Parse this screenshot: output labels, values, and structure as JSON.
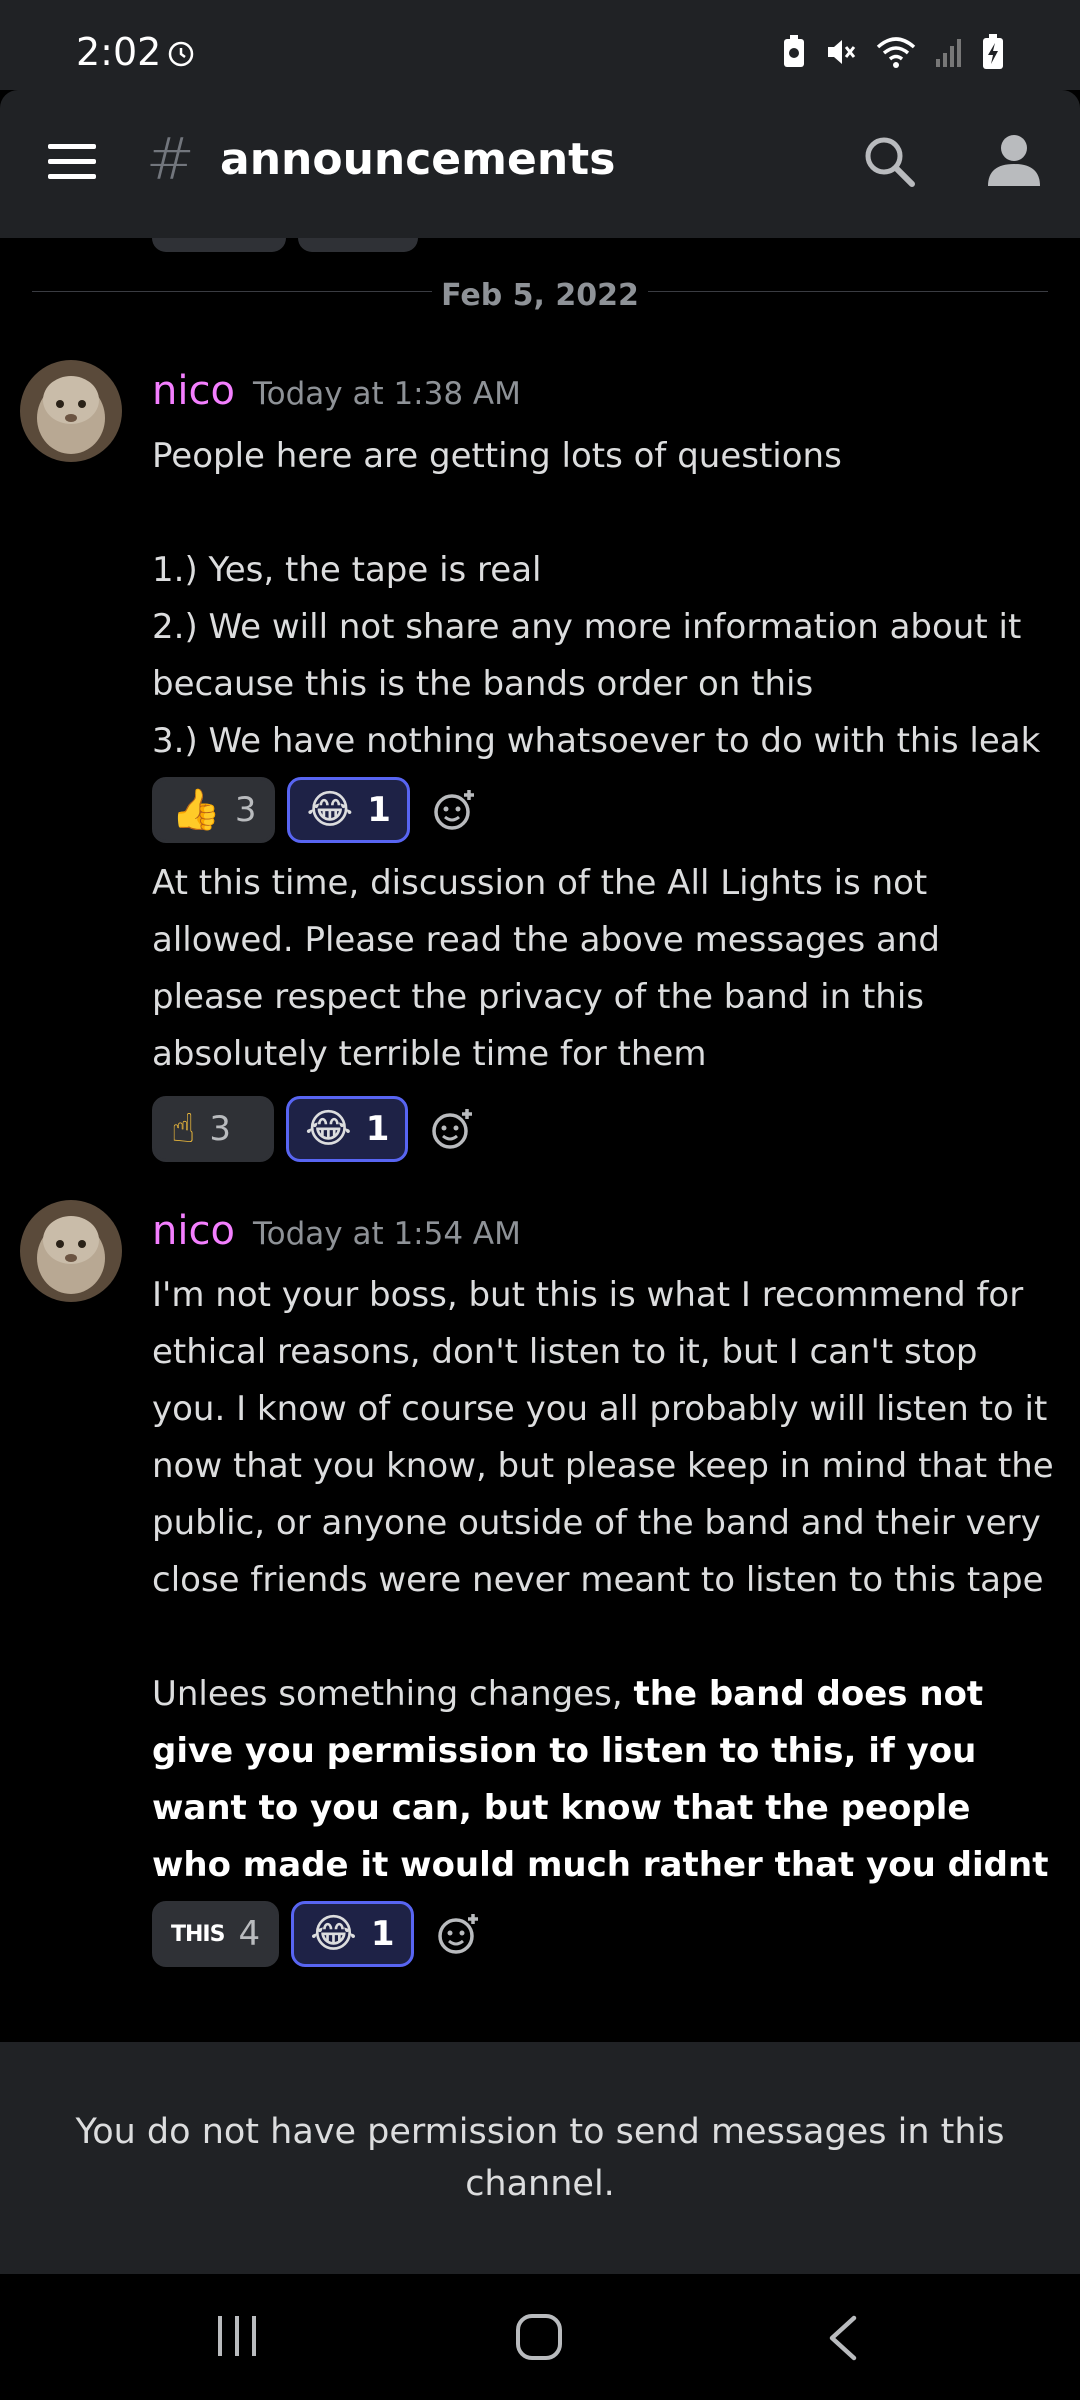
{
  "status_bar": {
    "time": "2:02"
  },
  "header": {
    "channel_name": "announcements"
  },
  "divider": {
    "date": "Feb 5, 2022"
  },
  "messages": [
    {
      "author": "nico",
      "timestamp": "Today at 1:38 AM",
      "lines": [
        "People here are getting lots of questions",
        "1.) Yes, the tape is real",
        "2.) We will not share any more information about it because this is the bands order on this",
        "3.) We have nothing whatsoever to do with this leak"
      ],
      "reactions": [
        {
          "emoji": "👍",
          "count": "3",
          "me": false
        },
        {
          "emoji": "😂",
          "count": "1",
          "me": true
        }
      ]
    },
    {
      "author": "nico",
      "timestamp": "",
      "lines": [
        "At this time, discussion of the All Lights is not allowed. Please read the above messages and please respect the privacy of the band in this absolutely terrible time for them"
      ],
      "reactions": [
        {
          "emoji": "☝",
          "count": "3",
          "me": false
        },
        {
          "emoji": "😂",
          "count": "1",
          "me": true
        }
      ]
    },
    {
      "author": "nico",
      "timestamp": "Today at 1:54 AM",
      "paragraph1": "I'm not your boss, but this is what I recommend for ethical reasons, don't listen to it, but I can't stop you. I know of course you all probably will listen to it now that you know, but please keep in mind that the public, or anyone outside of the band and their very close friends were never meant to listen to this tape",
      "paragraph2_plain": "Unlees something changes, ",
      "paragraph2_bold": "the band does not give you permission to listen to this, if you want to you can, but know that the people who made it would much rather that you didnt",
      "reactions": [
        {
          "emoji": "THIS",
          "count": "4",
          "me": false
        },
        {
          "emoji": "😂",
          "count": "1",
          "me": true
        }
      ]
    }
  ],
  "footer": {
    "permission_text": "You do not have permission to send messages in this channel."
  },
  "colors": {
    "author": "#f47fff",
    "accent": "#5865f2",
    "panel": "#202225",
    "reaction_bg": "#2f3136"
  }
}
